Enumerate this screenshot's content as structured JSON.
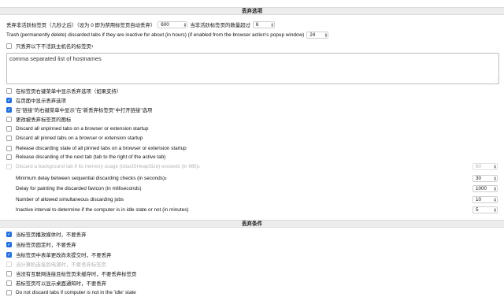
{
  "sections": {
    "discard_options": "丢弃选项",
    "discard_conditions": "丢弃条件"
  },
  "top": {
    "inactive_label": "丢弃非活跃标签页（几秒之后）（设为 0 即为禁用标签页自动丢弃）",
    "inactive_value": "600",
    "count_label": "当非活跃标签页的数量超过",
    "count_value": "6",
    "trash_label": "Trash (permanently delete) discarded tabs if they are inactive for about (in hours) (if enabled from the browser action's popup window)",
    "trash_value": "24",
    "hostname_only_label": "只丢弃以下不活跃主机名的标签页",
    "hostname_only_sup": "1",
    "hostnames_placeholder": "comma separated list of hostnames"
  },
  "options": [
    {
      "label": "在标签页右键菜单中显示丢弃选项（如果支持）",
      "checked": false
    },
    {
      "label": "在页面中显示丢弃选项",
      "checked": true
    },
    {
      "label": "在\"链接\"的右键菜单中显示\"在\"新丢弃标签页\"中打开链接\"选项",
      "checked": true
    },
    {
      "label": "更改被丢弃标签页的图标",
      "checked": false
    },
    {
      "label": "Discard all unpinned tabs on a browser or extension startup",
      "checked": false
    },
    {
      "label": "Discard all pinned tabs on a browser or extension startup",
      "checked": false
    },
    {
      "label": "Release discarding state of all pinned tabs on a browser or extension startup",
      "checked": false
    },
    {
      "label": "Release discarding of the next tab (tab to the right of the active tab)",
      "checked": false
    }
  ],
  "memory": {
    "label": "Discard a background tab if its memory usage (totalJSHeapSize) exceeds (in MB)",
    "sup": "2",
    "value": "60"
  },
  "numeric": [
    {
      "label": "Minimum delay between sequential discarding checks (in seconds)",
      "sup": "3",
      "value": "30"
    },
    {
      "label": "Delay for painting the discarded favicon (in milliseconds)",
      "sup": "",
      "value": "1000"
    },
    {
      "label": "Number of allowed simultaneous discarding jobs",
      "sup": "",
      "value": "10"
    },
    {
      "label": "Inactive interval to determine if the computer is in idle state or not (in minutes)",
      "sup": "",
      "value": "5"
    }
  ],
  "conditions": [
    {
      "label": "当标签页播放媒体时，不要丢弃",
      "checked": true,
      "disabled": false
    },
    {
      "label": "当标签页固定时，不要丢弃",
      "checked": true,
      "disabled": false
    },
    {
      "label": "当标签页中表单更改尚未提交时，不要丢弃",
      "checked": true,
      "disabled": false
    },
    {
      "label": "当计算机连接到电源时，不要丢弃标签页",
      "checked": false,
      "disabled": true
    },
    {
      "label": "当没有互联网连接且标签页未缓存时，不要丢弃标签页",
      "checked": false,
      "disabled": false
    },
    {
      "label": "若标签页可以显示桌面通知时，不要丢弃",
      "checked": false,
      "disabled": false
    },
    {
      "label": "Do not discard tabs if computer is not in the 'idle' state",
      "checked": false,
      "disabled": false
    }
  ],
  "colors": {
    "checkbox_accent": "#1f6fe5",
    "section_bg": "#ececec"
  }
}
